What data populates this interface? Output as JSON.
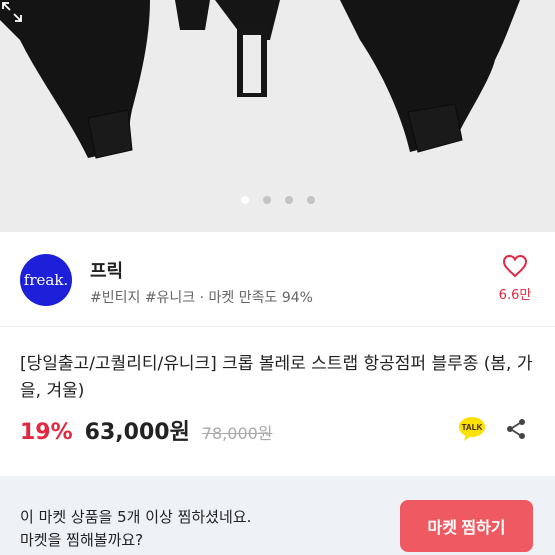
{
  "gallery": {
    "dot_count": 4,
    "active_index": 0,
    "expand_icon": "expand-icon"
  },
  "shop": {
    "logo_text": "freak.",
    "name": "프릭",
    "tags": "#빈티지 #유니크 · 마켓 만족도 94%",
    "like_count": "6.6만",
    "colors": {
      "logo_bg": "#1d20d8",
      "like": "#e2283f"
    }
  },
  "product": {
    "title": "[당일출고/고퀄리티/유니크] 크롭 볼레로 스트랩 항공점퍼 블루종 (봄, 가을, 겨울)",
    "discount": "19%",
    "price": "63,000원",
    "original_price": "78,000원",
    "talk_label": "TALK"
  },
  "banner": {
    "line1": "이 마켓 상품을 5개 이상 찜하셨네요.",
    "line2": "마켓을 찜해볼까요?",
    "button_label": "마켓 찜하기",
    "colors": {
      "bg": "#eef2f7",
      "button": "#ef5a62"
    }
  }
}
